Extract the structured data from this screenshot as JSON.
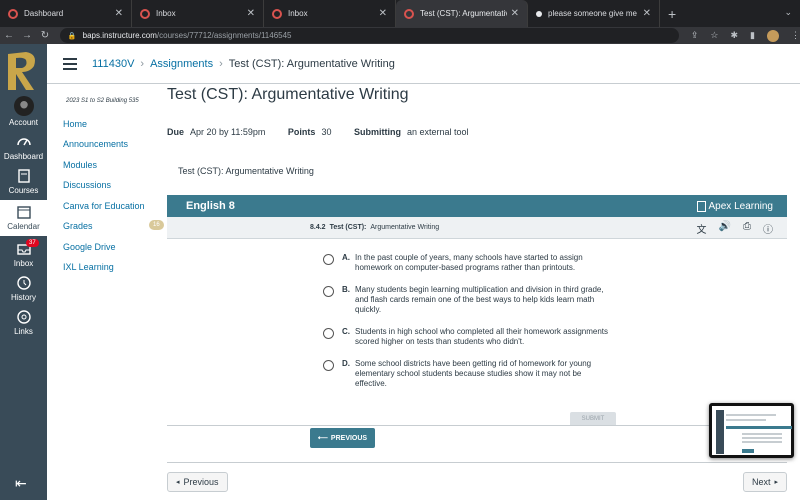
{
  "browser": {
    "tabs": [
      {
        "title": "Dashboard",
        "active": false
      },
      {
        "title": "Inbox",
        "active": false
      },
      {
        "title": "Inbox",
        "active": false
      },
      {
        "title": "Test (CST): Argumentative Writ",
        "active": true
      },
      {
        "title": "please someone give me the a",
        "active": false
      }
    ],
    "url_host": "baps.instructure.com",
    "url_path": "/courses/77712/assignments/1146545"
  },
  "global_nav": {
    "items": [
      {
        "label": "Account"
      },
      {
        "label": "Dashboard"
      },
      {
        "label": "Courses"
      },
      {
        "label": "Calendar"
      },
      {
        "label": "Inbox",
        "badge": "37"
      },
      {
        "label": "History"
      },
      {
        "label": "Links"
      }
    ]
  },
  "breadcrumb": {
    "course": "111430V",
    "section": "Assignments",
    "current": "Test (CST): Argumentative Writing"
  },
  "course_nav": {
    "term": "2023 S1 to S2 Building 535",
    "items": [
      {
        "label": "Home"
      },
      {
        "label": "Announcements"
      },
      {
        "label": "Modules"
      },
      {
        "label": "Discussions"
      },
      {
        "label": "Canva for Education"
      },
      {
        "label": "Grades",
        "badge": "16"
      },
      {
        "label": "Google Drive"
      },
      {
        "label": "IXL Learning"
      }
    ]
  },
  "assignment": {
    "title": "Test (CST): Argumentative Writing",
    "due_label": "Due",
    "due_value": "Apr 20 by 11:59pm",
    "points_label": "Points",
    "points_value": "30",
    "submitting_label": "Submitting",
    "submitting_value": "an external tool",
    "tool_title": "Test (CST): Argumentative Writing"
  },
  "apex": {
    "course": "English 8",
    "brand": "Apex Learning",
    "lesson_num": "8.4.2",
    "lesson_type": "Test (CST):",
    "lesson_name": "Argumentative Writing",
    "submit_label": "SUBMIT",
    "previous_label": "PREVIOUS",
    "accent": "#3b7a8e",
    "options": [
      {
        "letter": "A.",
        "text": "In the past couple of years, many schools have started to assign homework on computer-based programs rather than printouts."
      },
      {
        "letter": "B.",
        "text": "Many students begin learning multiplication and division in third grade, and flash cards remain one of the best ways to help kids learn math quickly."
      },
      {
        "letter": "C.",
        "text": "Students in high school who completed all their homework assignments scored higher on tests than students who didn't."
      },
      {
        "letter": "D.",
        "text": "Some school districts have been getting rid of homework for young elementary school students because studies show it may not be effective."
      }
    ]
  },
  "pager": {
    "previous": "Previous",
    "next": "Next"
  },
  "colors": {
    "nav_bg": "#394b58",
    "link": "#0770a3"
  }
}
